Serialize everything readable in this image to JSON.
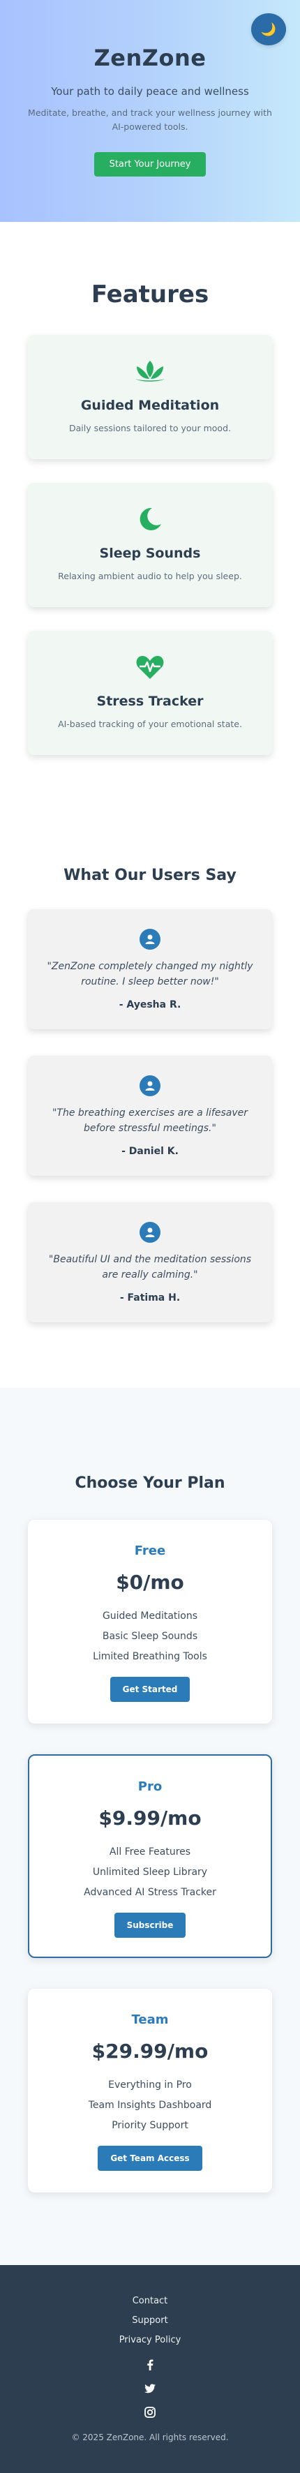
{
  "hero": {
    "brand": "ZenZone",
    "tagline": "Your path to daily peace and wellness",
    "description": "Meditate, breathe, and track your wellness journey with AI-powered tools.",
    "cta_label": "Start Your Journey",
    "theme_toggle_icon": "🌙"
  },
  "features": {
    "title": "Features",
    "items": [
      {
        "icon": "lotus-icon",
        "title": "Guided Meditation",
        "desc": "Daily sessions tailored to your mood."
      },
      {
        "icon": "moon-icon",
        "title": "Sleep Sounds",
        "desc": "Relaxing ambient audio to help you sleep."
      },
      {
        "icon": "heartbeat-icon",
        "title": "Stress Tracker",
        "desc": "AI-based tracking of your emotional state."
      }
    ]
  },
  "testimonials": {
    "title": "What Our Users Say",
    "items": [
      {
        "quote": "\"ZenZone completely changed my nightly routine. I sleep better now!\"",
        "author": "- Ayesha R."
      },
      {
        "quote": "\"The breathing exercises are a lifesaver before stressful meetings.\"",
        "author": "- Daniel K."
      },
      {
        "quote": "\"Beautiful UI and the meditation sessions are really calming.\"",
        "author": "- Fatima H."
      }
    ]
  },
  "pricing": {
    "title": "Choose Your Plan",
    "plans": [
      {
        "name": "Free",
        "price": "$0/mo",
        "features": [
          "Guided Meditations",
          "Basic Sleep Sounds",
          "Limited Breathing Tools"
        ],
        "button": "Get Started"
      },
      {
        "name": "Pro",
        "price": "$9.99/mo",
        "features": [
          "All Free Features",
          "Unlimited Sleep Library",
          "Advanced AI Stress Tracker"
        ],
        "button": "Subscribe"
      },
      {
        "name": "Team",
        "price": "$29.99/mo",
        "features": [
          "Everything in Pro",
          "Team Insights Dashboard",
          "Priority Support"
        ],
        "button": "Get Team Access"
      }
    ]
  },
  "footer": {
    "links": [
      "Contact",
      "Support",
      "Privacy Policy"
    ],
    "socials": [
      "facebook-icon",
      "twitter-icon",
      "instagram-icon"
    ],
    "copyright": "© 2025 ZenZone. All rights reserved."
  },
  "colors": {
    "accent_green": "#27ae60",
    "accent_blue": "#2b7bb9",
    "dark": "#2c3e50"
  }
}
